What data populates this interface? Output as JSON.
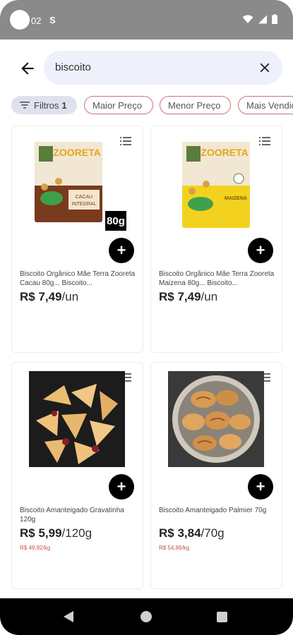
{
  "status_bar": {
    "time": "02",
    "app_badge": "S"
  },
  "search": {
    "query": "biscoito"
  },
  "filters": {
    "label": "Filtros",
    "count": "1",
    "chips": [
      "Maior Preço",
      "Menor Preço",
      "Mais Vendidos"
    ]
  },
  "products": [
    {
      "name": "Biscoito Orgânico Mãe Terra Zooreta Cacau 80g... Biscoito...",
      "price": "R$ 7,49",
      "unit": "/un",
      "unit_price": "",
      "image_brand": "ZOORETA",
      "image_flavor": "CACAU INTEGRAL",
      "image_badge": "80g",
      "image_color": "#7a3a1e"
    },
    {
      "name": "Biscoito Orgânico Mãe Terra Zooreta Maizena 80g... Biscoito...",
      "price": "R$ 7,49",
      "unit": "/un",
      "unit_price": "",
      "image_brand": "ZOORETA",
      "image_flavor": "MAIZENA",
      "image_badge": "",
      "image_color": "#f2d21f"
    },
    {
      "name": "Biscoito Amanteigado Gravatinha 120g",
      "price": "R$ 5,99",
      "unit": "/120g",
      "unit_price": "R$ 49,92/kg",
      "image_brand": "",
      "image_flavor": "",
      "image_badge": "",
      "image_color": "#e8b96a"
    },
    {
      "name": "Biscoito Amanteigado Palmier 70g",
      "price": "R$ 3,84",
      "unit": "/70g",
      "unit_price": "R$ 54,86/kg",
      "image_brand": "",
      "image_flavor": "",
      "image_badge": "",
      "image_color": "#d89a55"
    }
  ],
  "colors": {
    "chip_outline": "#c9767a",
    "unit_price": "#c0504d",
    "search_bg": "#eef0fb"
  }
}
